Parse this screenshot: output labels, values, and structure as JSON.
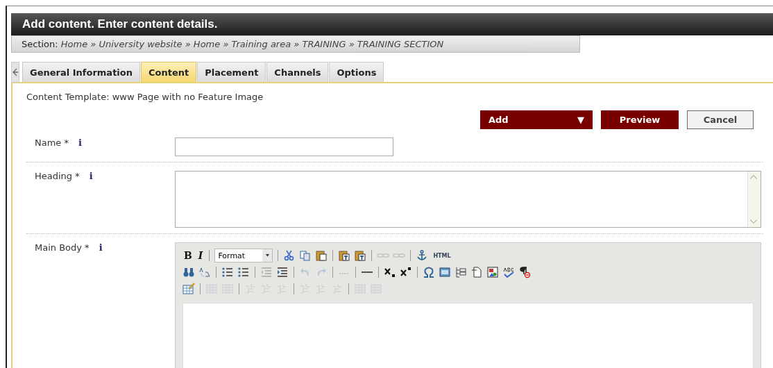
{
  "header": {
    "title": "Add content. Enter content details."
  },
  "section": {
    "label": "Section:",
    "path": "Home » University website » Home » Training area » TRAINING » TRAINING SECTION"
  },
  "tabs": [
    {
      "label": "General Information",
      "selected": false
    },
    {
      "label": "Content",
      "selected": true
    },
    {
      "label": "Placement",
      "selected": false
    },
    {
      "label": "Channels",
      "selected": false
    },
    {
      "label": "Options",
      "selected": false
    }
  ],
  "template": "Content Template: www Page with no Feature Image",
  "buttons": [
    {
      "kind": "dropdown",
      "label": "Add",
      "caret": "▼"
    },
    {
      "kind": "primary",
      "label": "Preview"
    },
    {
      "kind": "secondary",
      "label": "Cancel"
    }
  ],
  "fields": [
    {
      "kind": "input",
      "label": "Name *",
      "info": "i"
    },
    {
      "kind": "textarea",
      "label": "Heading *",
      "info": "i"
    },
    {
      "kind": "editor",
      "label": "Main Body *",
      "info": "i"
    }
  ],
  "toolbar": [
    [
      {
        "kind": "text",
        "label": "B",
        "disabled": false
      },
      {
        "kind": "text-italic",
        "label": "I",
        "disabled": false
      },
      {
        "kind": "sep"
      },
      {
        "kind": "select",
        "label": "Format"
      },
      {
        "kind": "sep"
      },
      {
        "kind": "cut",
        "disabled": false
      },
      {
        "kind": "copy",
        "disabled": false
      },
      {
        "kind": "paste",
        "disabled": false
      },
      {
        "kind": "sep"
      },
      {
        "kind": "paste-text",
        "disabled": false
      },
      {
        "kind": "paste-word",
        "disabled": false
      },
      {
        "kind": "sep"
      },
      {
        "kind": "link",
        "disabled": true
      },
      {
        "kind": "unlink",
        "disabled": true
      },
      {
        "kind": "sep"
      },
      {
        "kind": "anchor",
        "disabled": false
      },
      {
        "kind": "text-small",
        "label": "HTML",
        "disabled": false
      }
    ],
    [
      {
        "kind": "find",
        "disabled": false
      },
      {
        "kind": "replace",
        "disabled": false
      },
      {
        "kind": "sep"
      },
      {
        "kind": "bullets",
        "disabled": false
      },
      {
        "kind": "numbers",
        "disabled": false
      },
      {
        "kind": "sep"
      },
      {
        "kind": "outdent",
        "disabled": true
      },
      {
        "kind": "indent",
        "disabled": false
      },
      {
        "kind": "sep"
      },
      {
        "kind": "undo",
        "disabled": true
      },
      {
        "kind": "redo",
        "disabled": true
      },
      {
        "kind": "sep"
      },
      {
        "kind": "dots",
        "disabled": true
      },
      {
        "kind": "sep"
      },
      {
        "kind": "rule",
        "disabled": false
      },
      {
        "kind": "sep"
      },
      {
        "kind": "subscript",
        "disabled": false
      },
      {
        "kind": "superscript",
        "disabled": false
      },
      {
        "kind": "sep"
      },
      {
        "kind": "omega",
        "disabled": false
      },
      {
        "kind": "frame",
        "disabled": false
      },
      {
        "kind": "tree",
        "disabled": false
      },
      {
        "kind": "doc",
        "disabled": false
      },
      {
        "kind": "image",
        "disabled": false
      },
      {
        "kind": "spell",
        "disabled": false
      },
      {
        "kind": "pilcrow",
        "disabled": false
      }
    ],
    [
      {
        "kind": "table-edit",
        "disabled": false
      },
      {
        "kind": "sep"
      },
      {
        "kind": "table",
        "disabled": true
      },
      {
        "kind": "table",
        "disabled": true
      },
      {
        "kind": "sep"
      },
      {
        "kind": "cells",
        "disabled": true
      },
      {
        "kind": "cells",
        "disabled": true
      },
      {
        "kind": "cells",
        "disabled": true
      },
      {
        "kind": "sep"
      },
      {
        "kind": "cells",
        "disabled": true
      },
      {
        "kind": "cells",
        "disabled": true
      },
      {
        "kind": "cells",
        "disabled": true
      },
      {
        "kind": "sep"
      },
      {
        "kind": "table",
        "disabled": true
      },
      {
        "kind": "table",
        "disabled": true
      }
    ]
  ]
}
